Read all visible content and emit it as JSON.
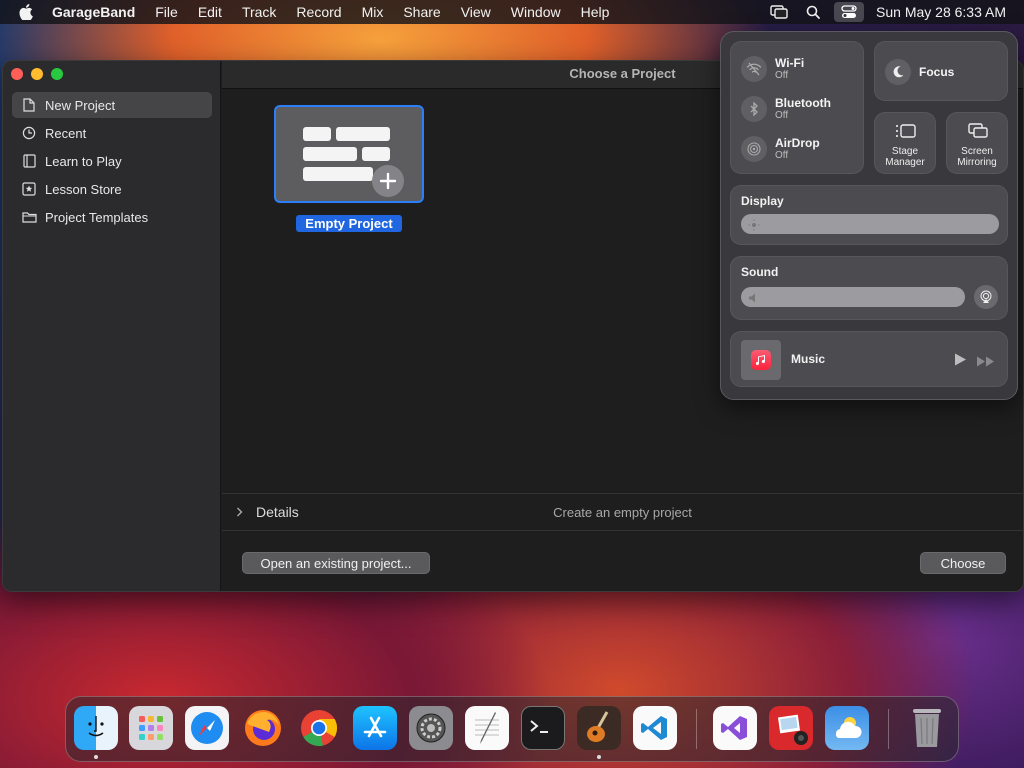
{
  "menubar": {
    "app_name": "GarageBand",
    "menus": [
      "File",
      "Edit",
      "Track",
      "Record",
      "Mix",
      "Share",
      "View",
      "Window",
      "Help"
    ],
    "clock": "Sun May 28  6:33 AM",
    "status_icons": [
      "screen-mirroring-icon",
      "search-icon",
      "control-center-icon"
    ]
  },
  "window": {
    "title": "Choose a Project",
    "sidebar": [
      {
        "label": "New Project",
        "icon": "document-icon",
        "selected": true
      },
      {
        "label": "Recent",
        "icon": "clock-icon"
      },
      {
        "label": "Learn to Play",
        "icon": "book-icon"
      },
      {
        "label": "Lesson Store",
        "icon": "star-box-icon"
      },
      {
        "label": "Project Templates",
        "icon": "folder-icon"
      }
    ],
    "template": {
      "label": "Empty Project"
    },
    "details_label": "Details",
    "details_description": "Create an empty project",
    "open_button": "Open an existing project...",
    "choose_button": "Choose"
  },
  "control_center": {
    "wifi": {
      "label": "Wi-Fi",
      "status": "Off"
    },
    "bluetooth": {
      "label": "Bluetooth",
      "status": "Off"
    },
    "airdrop": {
      "label": "AirDrop",
      "status": "Off"
    },
    "focus": {
      "label": "Focus"
    },
    "stage_manager": {
      "line1": "Stage",
      "line2": "Manager"
    },
    "screen_mirroring": {
      "line1": "Screen",
      "line2": "Mirroring"
    },
    "display": {
      "label": "Display"
    },
    "sound": {
      "label": "Sound"
    },
    "now_playing": {
      "label": "Music"
    }
  },
  "dock": {
    "apps": [
      "Finder",
      "Launchpad",
      "Safari",
      "Firefox",
      "Chrome",
      "App Store",
      "System Settings",
      "TextEdit",
      "Terminal",
      "GarageBand",
      "Visual Studio Code",
      "Visual Studio",
      "Photo Booth",
      "Weather",
      "Trash"
    ]
  },
  "colors": {
    "accent": "#2d7ff9",
    "selection": "#1f66e0"
  }
}
